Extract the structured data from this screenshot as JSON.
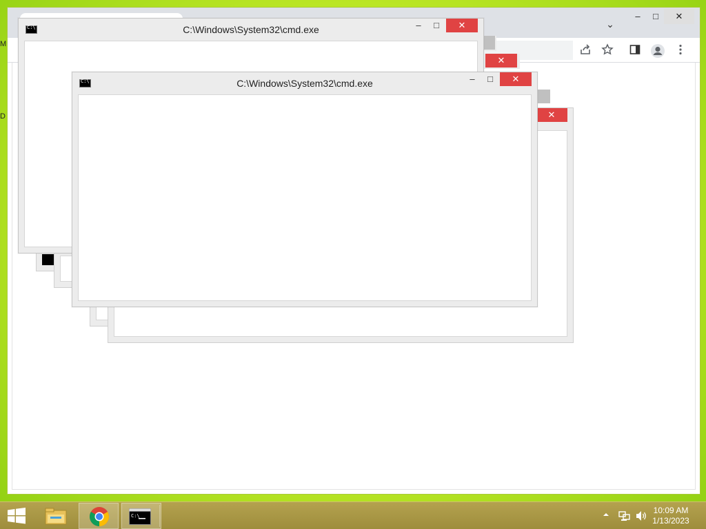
{
  "desktop": {
    "edge_labels": [
      "M",
      "D"
    ]
  },
  "chrome": {
    "controls": {
      "minimize": "–",
      "maximize": "□",
      "close": "✕"
    },
    "tab_dropdown": "⌄",
    "toolbar_icons": [
      "share-icon",
      "star-icon",
      "side-panel-icon",
      "profile-icon",
      "menu-icon"
    ]
  },
  "cmd_windows": [
    {
      "title": "C:\\Windows\\System32\\cmd.exe"
    },
    {
      "title": "C:\\Windows\\System32\\cmd.exe"
    }
  ],
  "window_buttons": {
    "minimize": "–",
    "maximize": "□",
    "close": "✕"
  },
  "taskbar": {
    "items": [
      "file-explorer",
      "google-chrome",
      "command-prompt"
    ],
    "clock": {
      "time": "10:09 AM",
      "date": "1/13/2023"
    },
    "tray_icons": [
      "show-hidden-icons",
      "network-icon",
      "volume-icon"
    ]
  },
  "colors": {
    "desktop": "#c6ec2a",
    "close_red": "#e04343",
    "window_frame": "#ececec",
    "taskbar": "#a89645"
  }
}
